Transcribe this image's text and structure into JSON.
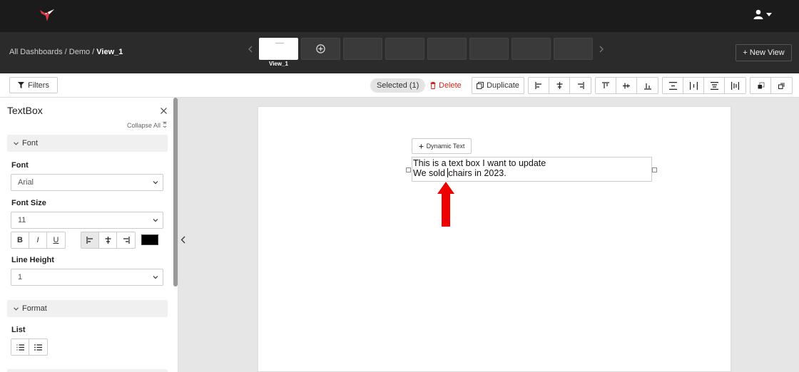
{
  "header": {
    "logo_icon": "hummingbird-logo",
    "user_icon": "user-icon"
  },
  "viewbar": {
    "breadcrumb": {
      "root": "All Dashboards",
      "sep": " / ",
      "parent": "Demo",
      "current": "View_1"
    },
    "active_view_label": "View_1",
    "new_view_label": "+ New View"
  },
  "toolbar": {
    "filters_label": "Filters",
    "selected_label": "Selected (1)",
    "delete_label": "Delete",
    "duplicate_label": "Duplicate",
    "accent_delete": "#d9261c"
  },
  "panel": {
    "title": "TextBox",
    "collapse_all": "Collapse All",
    "font_section": "Font",
    "font_label": "Font",
    "font_value": "Arial",
    "font_size_label": "Font Size",
    "font_size_value": "11",
    "bold": "B",
    "italic": "I",
    "underline": "U",
    "text_color": "#000000",
    "line_height_label": "Line Height",
    "line_height_value": "1",
    "format_section": "Format",
    "list_label": "List"
  },
  "canvas": {
    "dynamic_text_label": "Dynamic Text",
    "textbox_line1": "This is a text box I want to update",
    "textbox_line2_before": "We sold ",
    "textbox_line2_after": "chairs in 2023.",
    "annotation_color": "#ee0000"
  }
}
